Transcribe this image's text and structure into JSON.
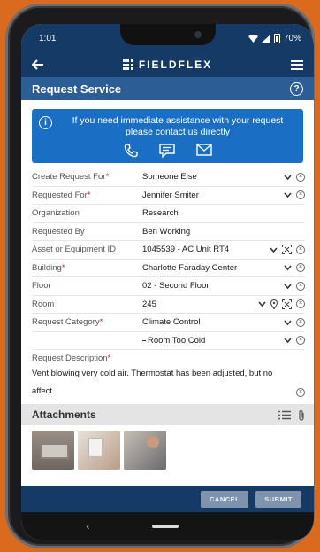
{
  "status_bar": {
    "time": "1:01",
    "battery": "70%"
  },
  "app": {
    "brand": "FIELDFLEX"
  },
  "page": {
    "title": "Request Service",
    "help_icon": "?"
  },
  "banner": {
    "info_icon": "i",
    "message": "If you need immediate assistance with your request please contact us directly",
    "icons": [
      "phone-icon",
      "message-icon",
      "mail-icon"
    ]
  },
  "form": {
    "rows": [
      {
        "label": "Create Request For",
        "required": true,
        "value": "Someone Else"
      },
      {
        "label": "Requested For",
        "required": true,
        "value": "Jennifer Smiter"
      },
      {
        "label": "Organization",
        "required": false,
        "value": "Research"
      },
      {
        "label": "Requested By",
        "required": false,
        "value": "Ben Working"
      },
      {
        "label": "Asset or Equipment ID",
        "required": false,
        "value": "1045539 - AC Unit RT4"
      },
      {
        "label": "Building",
        "required": true,
        "value": "Charlotte Faraday Center"
      },
      {
        "label": "Floor",
        "required": false,
        "value": "02 - Second Floor"
      },
      {
        "label": "Room",
        "required": false,
        "value": "245"
      },
      {
        "label": "Request Category",
        "required": true,
        "value": "Climate Control"
      },
      {
        "label": "",
        "required": false,
        "value": "Room Too Cold"
      }
    ],
    "description_label": "Request Description",
    "description": "Vent blowing very cold air.  Thermostat has been adjusted, but no affect"
  },
  "attachments": {
    "title": "Attachments"
  },
  "footer": {
    "cancel": "CANCEL",
    "submit": "SUBMIT"
  },
  "colors": {
    "header": "#163a66",
    "titlebar": "#2d5d95",
    "banner": "#1a6fc4",
    "required": "#d32020"
  }
}
